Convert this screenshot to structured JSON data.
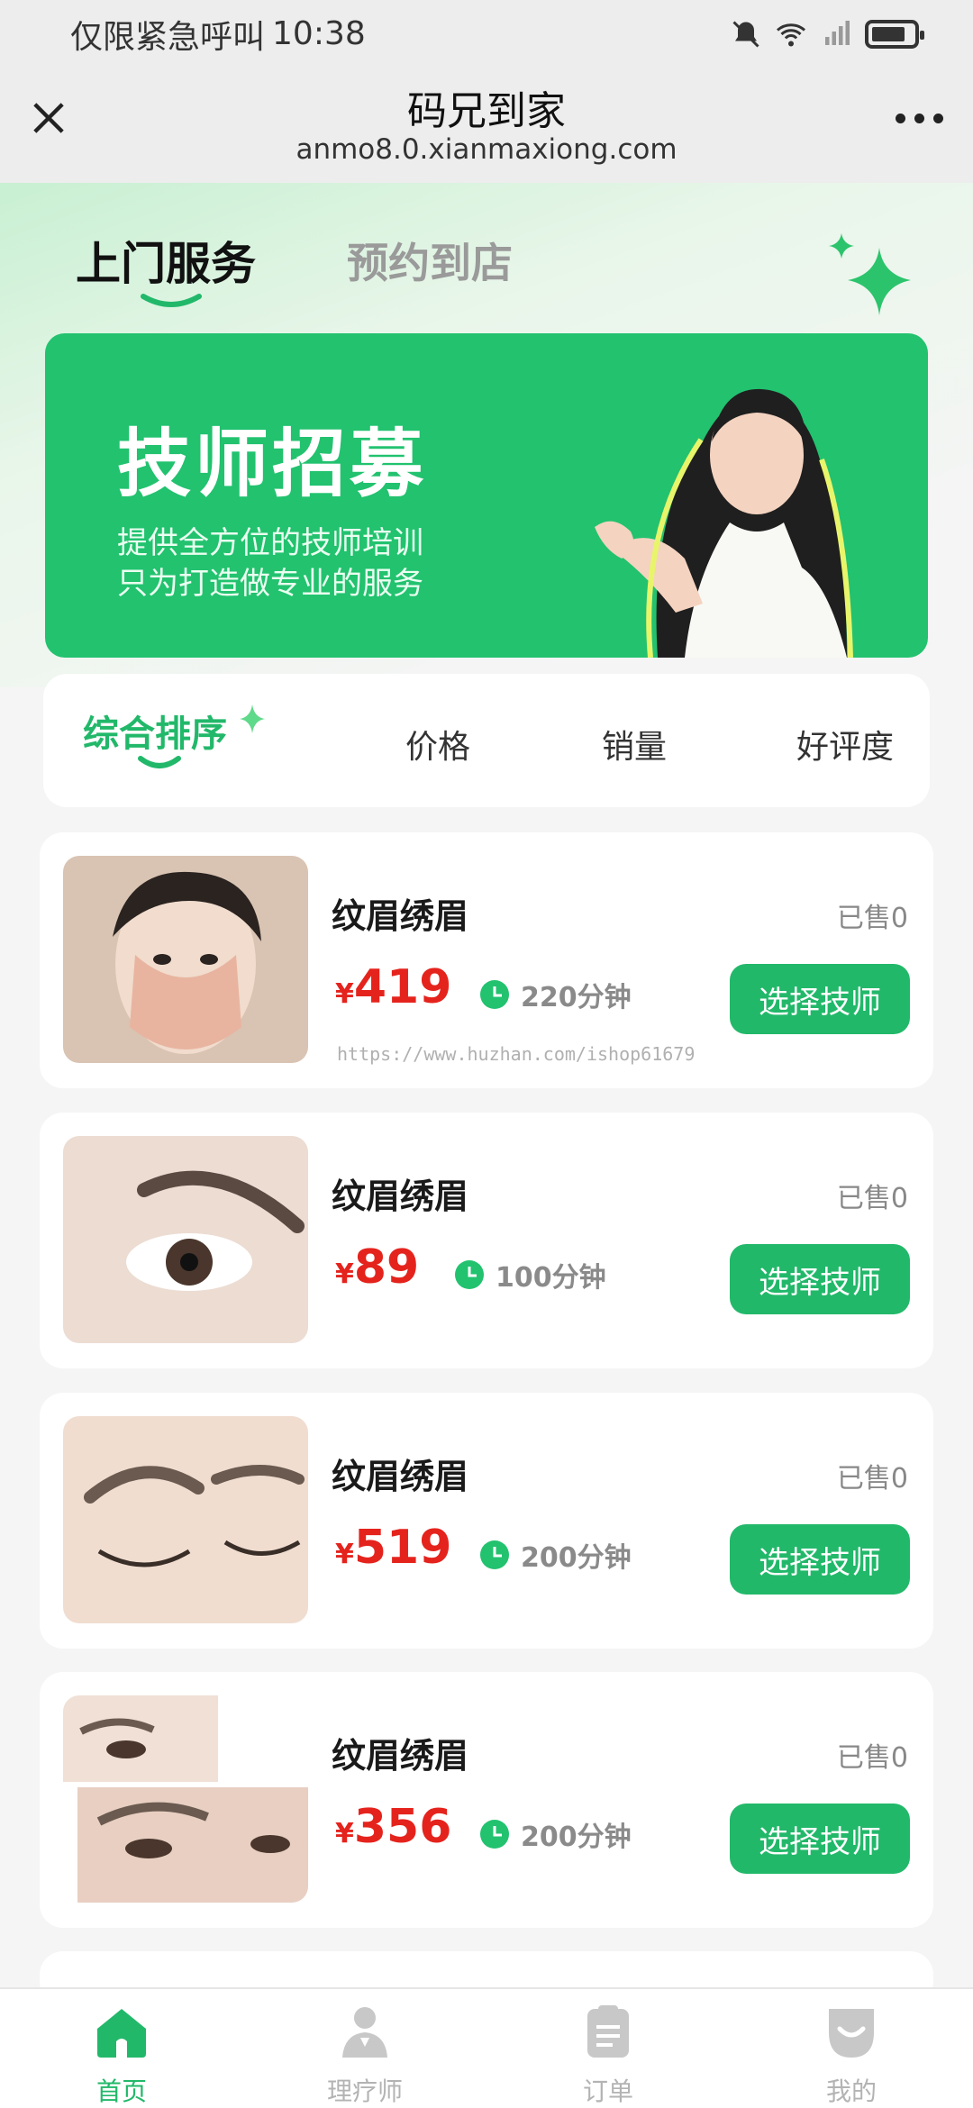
{
  "status_bar": {
    "carrier_text": "仅限紧急呼叫",
    "time": "10:38"
  },
  "title_bar": {
    "title": "码兄到家",
    "url": "anmo8.0.xianmaxiong.com"
  },
  "top_tabs": [
    {
      "label": "上门服务",
      "active": true
    },
    {
      "label": "预约到店",
      "active": false
    }
  ],
  "banner": {
    "title": "技师招募",
    "subtitle_1": "提供全方位的技师培训",
    "subtitle_2": "只为打造做专业的服务"
  },
  "sort_options": [
    {
      "label": "综合排序",
      "active": true
    },
    {
      "label": "价格",
      "active": false
    },
    {
      "label": "销量",
      "active": false
    },
    {
      "label": "好评度",
      "active": false
    }
  ],
  "services": [
    {
      "title": "纹眉绣眉",
      "sold": "已售0",
      "currency": "¥",
      "price": "419",
      "duration": "220分钟",
      "button": "选择技师",
      "watermark": "https://www.huzhan.com/ishop61679"
    },
    {
      "title": "纹眉绣眉",
      "sold": "已售0",
      "currency": "¥",
      "price": "89",
      "duration": "100分钟",
      "button": "选择技师"
    },
    {
      "title": "纹眉绣眉",
      "sold": "已售0",
      "currency": "¥",
      "price": "519",
      "duration": "200分钟",
      "button": "选择技师"
    },
    {
      "title": "纹眉绣眉",
      "sold": "已售0",
      "currency": "¥",
      "price": "356",
      "duration": "200分钟",
      "button": "选择技师"
    }
  ],
  "bottom_nav": [
    {
      "label": "首页",
      "icon": "home-icon",
      "active": true
    },
    {
      "label": "理疗师",
      "icon": "therapist-icon",
      "active": false
    },
    {
      "label": "订单",
      "icon": "order-icon",
      "active": false
    },
    {
      "label": "我的",
      "icon": "profile-icon",
      "active": false
    }
  ],
  "colors": {
    "accent": "#22b86a",
    "banner": "#22c26f",
    "price": "#e5231d"
  }
}
